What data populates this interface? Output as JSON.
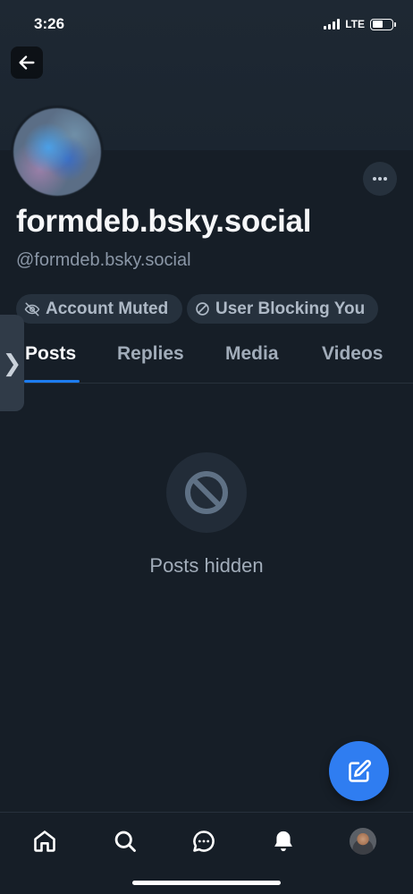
{
  "status_bar": {
    "time": "3:26",
    "network": "LTE",
    "battery_level": 0.55
  },
  "header": {
    "back_icon": "arrow-left-icon",
    "more_icon": "ellipsis-icon"
  },
  "profile": {
    "display_name": "formdeb.bsky.social",
    "handle": "@formdeb.bsky.social",
    "badges": [
      {
        "label": "Account Muted",
        "icon": "eye-off-icon"
      },
      {
        "label": "User Blocking You",
        "icon": "ban-icon"
      }
    ]
  },
  "tabs": [
    {
      "label": "Posts",
      "active": true
    },
    {
      "label": "Replies",
      "active": false
    },
    {
      "label": "Media",
      "active": false
    },
    {
      "label": "Videos",
      "active": false
    }
  ],
  "side_handle": {
    "glyph": "❯"
  },
  "empty_state": {
    "icon": "ban-icon",
    "text": "Posts hidden"
  },
  "compose": {
    "icon": "compose-icon"
  },
  "bottom_nav": [
    {
      "name": "home-icon"
    },
    {
      "name": "search-icon"
    },
    {
      "name": "chat-icon"
    },
    {
      "name": "bell-icon"
    },
    {
      "name": "profile-avatar"
    }
  ],
  "colors": {
    "background": "#161e27",
    "accent": "#1d7cf0",
    "fab": "#2f7df1",
    "pill_bg": "#26313d",
    "muted_text": "#8a96a6"
  }
}
